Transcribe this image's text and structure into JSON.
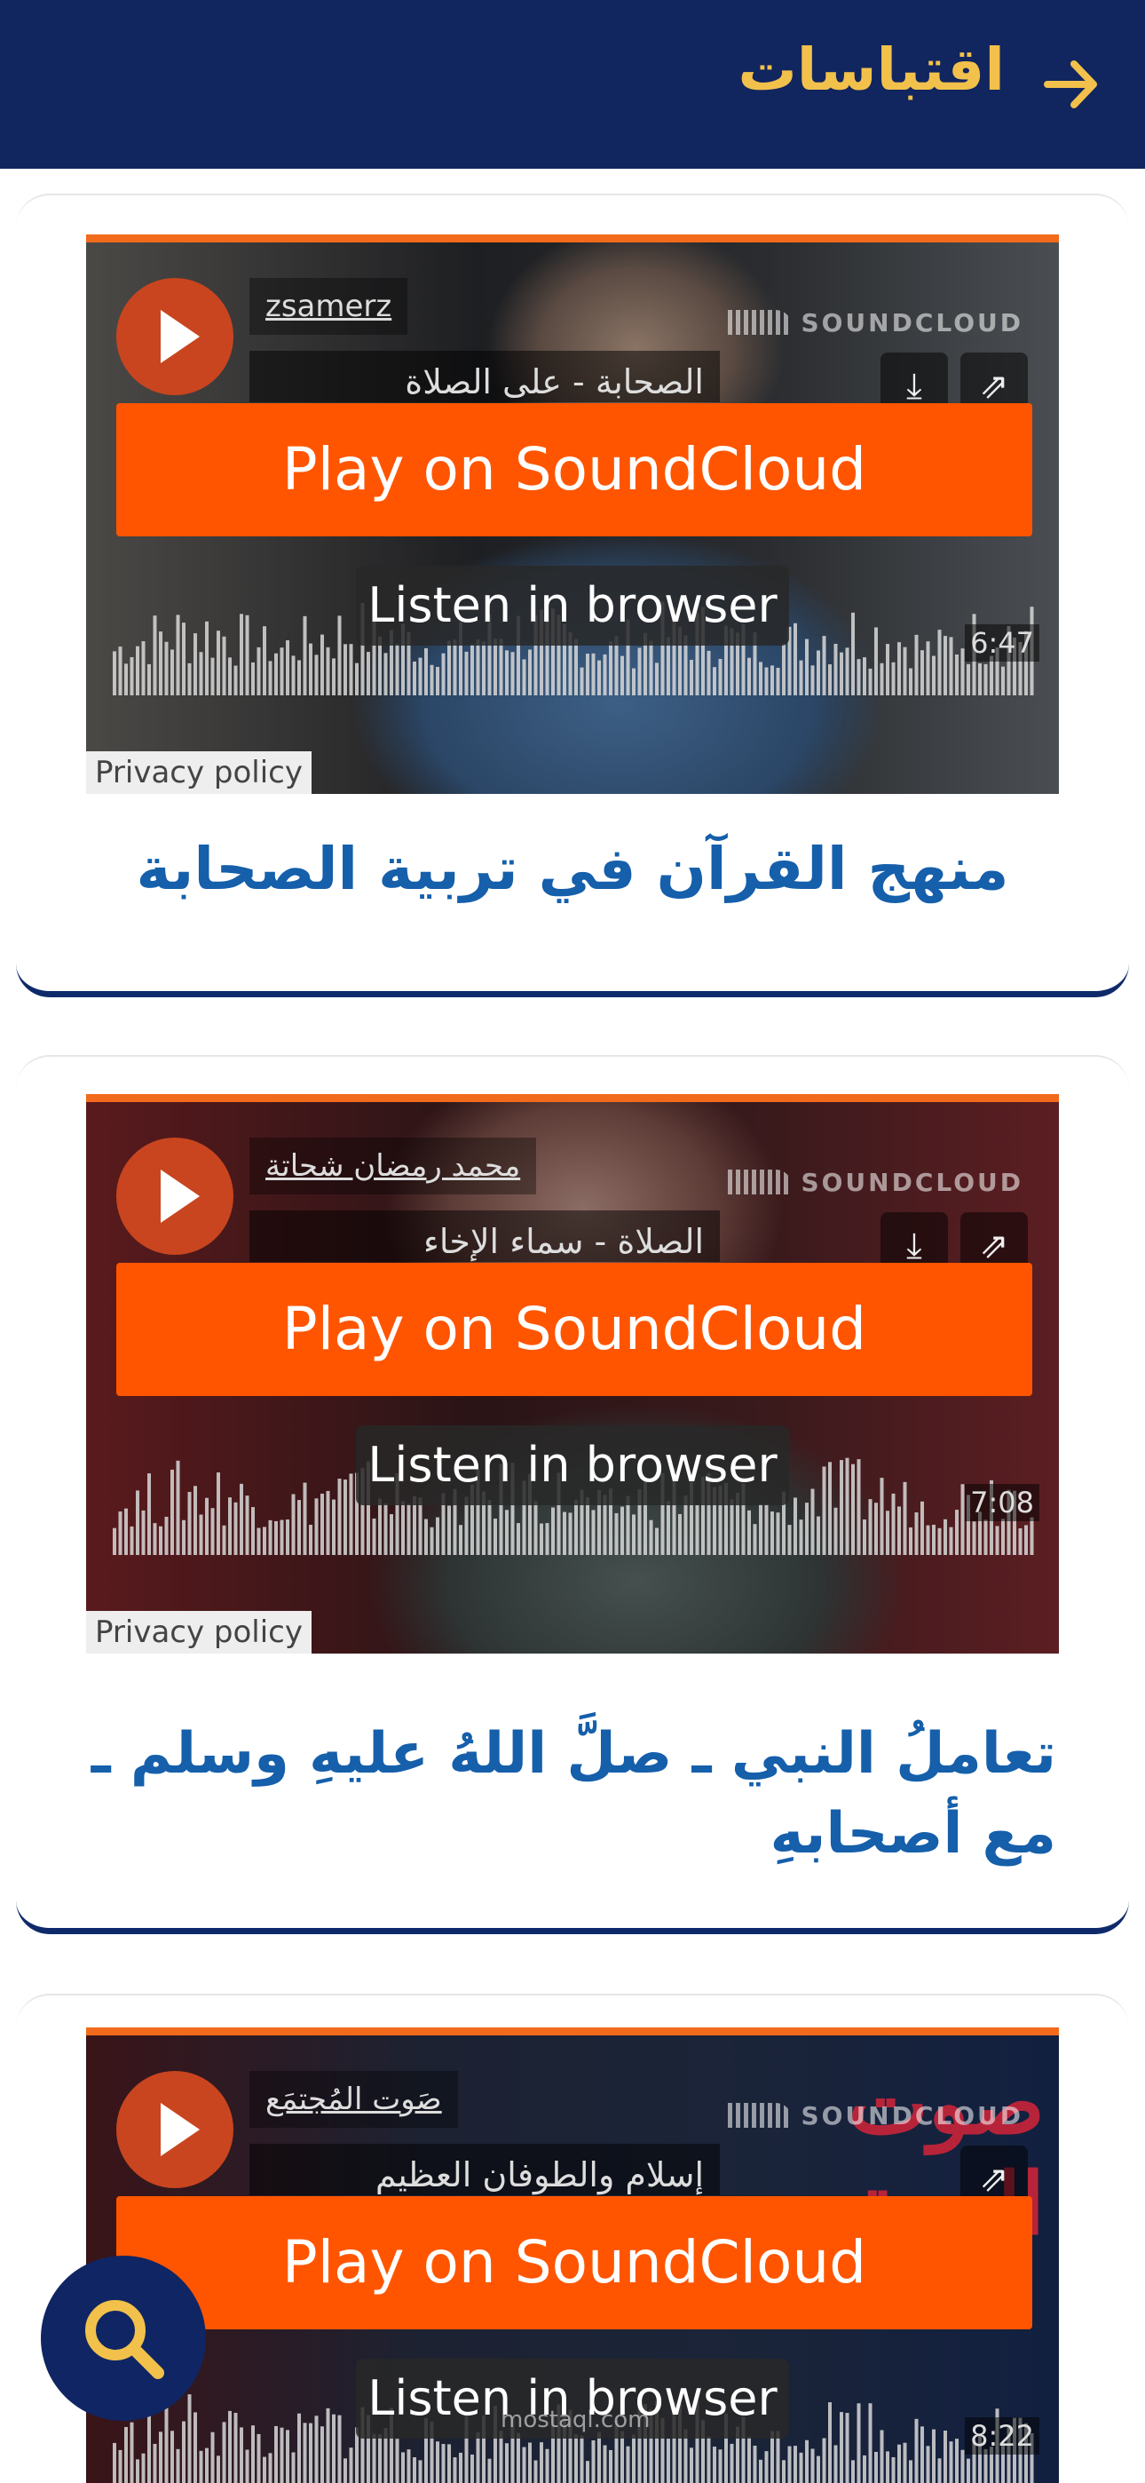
{
  "header": {
    "title": "اقتباسات",
    "back_icon": "arrow-right-icon",
    "background": "#11255f",
    "title_color": "#f2c14b"
  },
  "cards": [
    {
      "uploader": "zsamerz",
      "track_title": "الصحابة - على الصلاة",
      "play_button": "Play on SoundCloud",
      "listen_button": "Listen in browser",
      "duration": "6:47",
      "privacy": "Privacy policy",
      "brand": "SOUNDCLOUD",
      "title": "منهج القرآن في تربية الصحابة"
    },
    {
      "uploader": "محمد رمضان شحاتة",
      "track_title": "الصلاة - سماء الإخاء",
      "play_button": "Play on SoundCloud",
      "listen_button": "Listen in browser",
      "duration": "7:08",
      "privacy": "Privacy policy",
      "brand": "SOUNDCLOUD",
      "title": "تعاملُ النبي ـ صلَّ اللهُ عليهِ وسلم ـ مع أصحابهِ"
    },
    {
      "uploader": "صَوت المُجتمَع",
      "track_title": "إسلام والطوفان العظيم",
      "play_button": "Play on SoundCloud",
      "listen_button": "Listen in browser",
      "duration": "8:22",
      "brand": "SOUNDCLOUD",
      "artwork_text": "صوت المجتمع"
    }
  ],
  "fab": {
    "icon": "search-icon"
  },
  "watermark": "mostaql.com",
  "colors": {
    "accent": "#ff5500",
    "title_blue": "#155fab",
    "navy": "#11255f"
  }
}
